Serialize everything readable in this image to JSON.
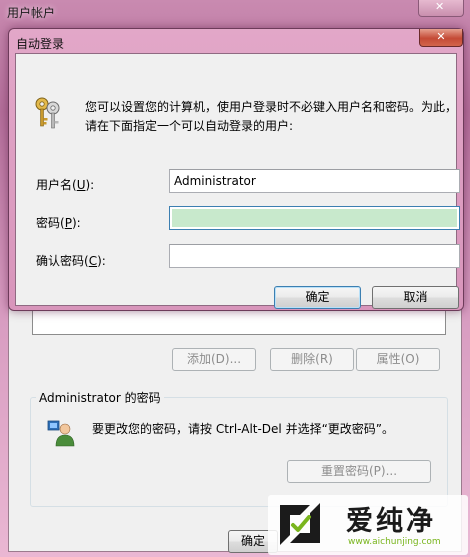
{
  "background_window": {
    "title": "用户帐户",
    "buttons": {
      "add": "添加(D)...",
      "remove": "删除(R)",
      "properties": "属性(O)"
    },
    "password_group": {
      "caption": "Administrator 的密码",
      "text": "要更改您的密码，请按 Ctrl-Alt-Del 并选择“更改密码”。",
      "reset_button": "重置密码(P)..."
    },
    "bottom_button": "确定"
  },
  "dialog": {
    "title": "自动登录",
    "close_icon": "close-icon",
    "intro_line1": "您可以设置您的计算机，使用户登录时不必键入用户名和密码。为此，",
    "intro_line2": "请在下面指定一个可以自动登录的用户:",
    "fields": {
      "username": {
        "label_pre": "用户名(",
        "label_key": "U",
        "label_post": "):",
        "value": "Administrator"
      },
      "password": {
        "label_pre": "密码(",
        "label_key": "P",
        "label_post": "):",
        "value": ""
      },
      "confirm_password": {
        "label_pre": "确认密码(",
        "label_key": "C",
        "label_post": "):",
        "value": ""
      }
    },
    "ok_button": "确定",
    "cancel_button": "取消"
  },
  "watermark": {
    "name": "爱纯净",
    "url": "www.aichunjing.com",
    "accent": "#79b51d"
  }
}
